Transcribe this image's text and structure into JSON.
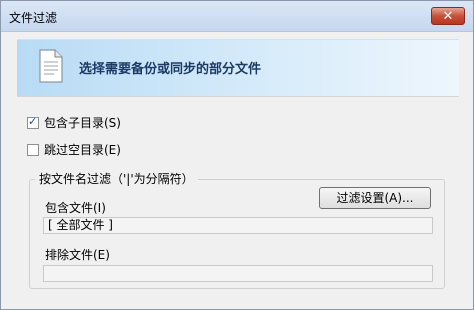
{
  "window": {
    "title": "文件过滤",
    "close_glyph": "✕"
  },
  "banner": {
    "text": "选择需要备份或同步的部分文件",
    "icon": "document-icon"
  },
  "options": {
    "include_subdirs": {
      "label": "包含子目录(S)",
      "checked": true
    },
    "skip_empty_dirs": {
      "label": "跳过空目录(E)",
      "checked": false
    }
  },
  "filter_group": {
    "label": "按文件名过滤（'|'为分隔符）",
    "settings_button": "过滤设置(A)...",
    "include": {
      "label": "包含文件(I)",
      "value": "[ 全部文件 ]"
    },
    "exclude": {
      "label": "排除文件(E)",
      "value": ""
    }
  },
  "colors": {
    "banner_text": "#1c3a66",
    "close_button": "#c7513b"
  }
}
